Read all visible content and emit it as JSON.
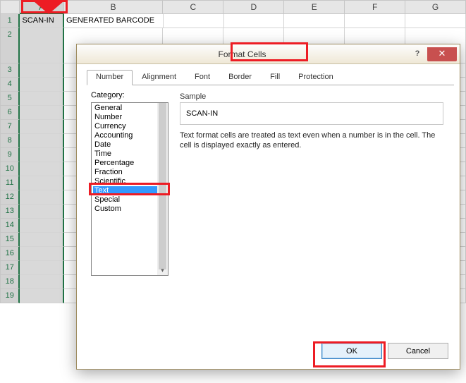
{
  "sheet": {
    "columns": [
      "A",
      "B",
      "C",
      "D",
      "E",
      "F",
      "G"
    ],
    "row_numbers": [
      1,
      2,
      3,
      4,
      5,
      6,
      7,
      8,
      9,
      10,
      11,
      12,
      13,
      14,
      15,
      16,
      17,
      18,
      19
    ],
    "cells": {
      "A1": "SCAN-IN",
      "B1": "GENERATED BARCODE"
    },
    "selected_column": "A"
  },
  "dialog": {
    "title": "Format Cells",
    "tabs": [
      "Number",
      "Alignment",
      "Font",
      "Border",
      "Fill",
      "Protection"
    ],
    "active_tab": "Number",
    "category_label": "Category:",
    "categories": [
      "General",
      "Number",
      "Currency",
      "Accounting",
      "Date",
      "Time",
      "Percentage",
      "Fraction",
      "Scientific",
      "Text",
      "Special",
      "Custom"
    ],
    "selected_category": "Text",
    "sample_label": "Sample",
    "sample_value": "SCAN-IN",
    "description": "Text format cells are treated as text even when a number is in the cell. The cell is displayed exactly as entered.",
    "buttons": {
      "ok": "OK",
      "cancel": "Cancel"
    }
  }
}
